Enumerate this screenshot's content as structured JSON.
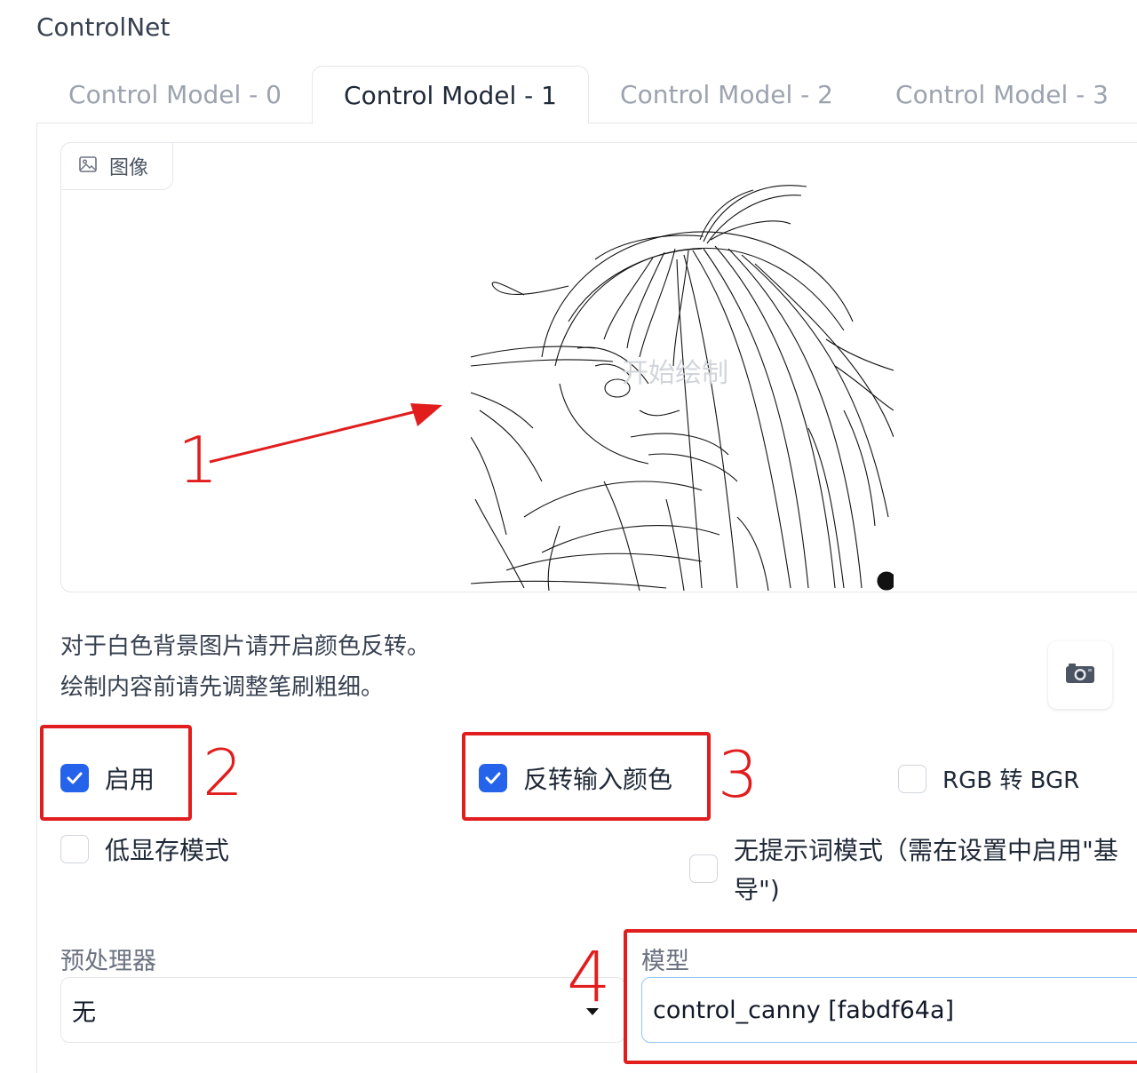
{
  "section": {
    "title": "ControlNet"
  },
  "tabs": [
    {
      "label": "Control Model - 0",
      "active": false
    },
    {
      "label": "Control Model - 1",
      "active": true
    },
    {
      "label": "Control Model - 2",
      "active": false
    },
    {
      "label": "Control Model - 3",
      "active": false
    }
  ],
  "image_panel": {
    "label": "图像",
    "icon": "image-icon",
    "draw_hint": "开始绘制"
  },
  "hints": {
    "line1": "对于白色背景图片请开启颜色反转。",
    "line2": "绘制内容前请先调整笔刷粗细。"
  },
  "checkboxes": {
    "enable": {
      "label": "启用",
      "checked": true
    },
    "invert": {
      "label": "反转输入颜色",
      "checked": true
    },
    "rgb_bgr": {
      "label": "RGB 转 BGR",
      "checked": false
    },
    "low_vram": {
      "label": "低显存模式",
      "checked": false
    },
    "guess_mode_line1": "无提示词模式（需在设置中启用\"基",
    "guess_mode_line2": "导\")",
    "guess_mode_checked": false
  },
  "preprocessor": {
    "label": "预处理器",
    "value": "无"
  },
  "model": {
    "label": "模型",
    "value": "control_canny [fabdf64a]"
  },
  "annotations": [
    "1",
    "2",
    "3",
    "4"
  ],
  "colors": {
    "accent": "#2563eb",
    "annotation": "#e11d1d"
  }
}
